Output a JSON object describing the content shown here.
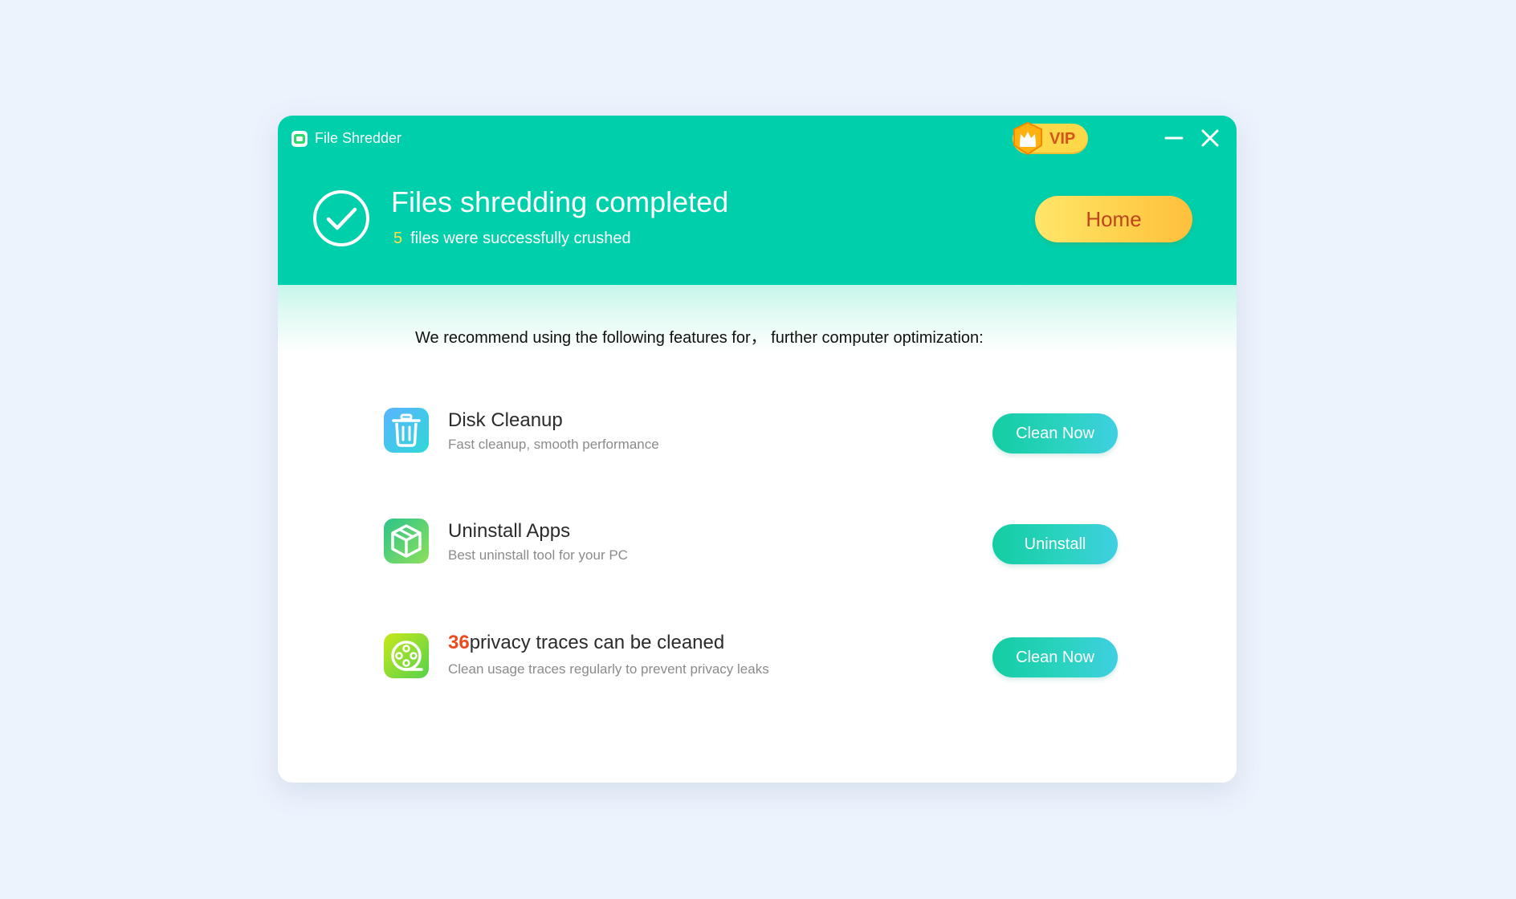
{
  "window": {
    "title": "File Shredder",
    "vip_label": "VIP",
    "minimize_icon": "minus-icon",
    "close_icon": "close-icon"
  },
  "status": {
    "title": "Files shredding completed",
    "count": "5",
    "subtitle": "files were successfully crushed",
    "home_label": "Home"
  },
  "recommend_text": "We recommend using the following features for， further computer optimization:",
  "features": [
    {
      "icon": "trash-icon",
      "title": "Disk Cleanup",
      "description": "Fast cleanup, smooth performance",
      "button": "Clean Now"
    },
    {
      "icon": "box-icon",
      "title": "Uninstall Apps",
      "description": "Best uninstall tool for your PC",
      "button": "Uninstall"
    },
    {
      "icon": "privacy-film-icon",
      "count": "36",
      "title": "privacy traces can be cleaned",
      "description": "Clean usage traces regularly to prevent privacy leaks",
      "button": "Clean Now"
    }
  ],
  "colors": {
    "header": "#00cfab",
    "accent_yellow": "#ffd24d",
    "home_text": "#c0441b",
    "highlight_number": "#ec4a1f",
    "button_gradient_start": "#14cda3",
    "button_gradient_end": "#3fcfe2"
  }
}
